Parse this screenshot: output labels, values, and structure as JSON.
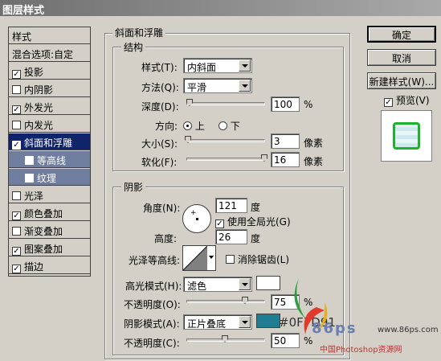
{
  "window": {
    "title": "图层样式"
  },
  "sidebar": {
    "items": [
      {
        "label": "样式",
        "checkbox": false,
        "checked": false,
        "state": "normal"
      },
      {
        "label": "混合选项:自定",
        "checkbox": false,
        "checked": false,
        "state": "normal"
      },
      {
        "label": "投影",
        "checkbox": true,
        "checked": true,
        "state": "normal"
      },
      {
        "label": "内阴影",
        "checkbox": true,
        "checked": false,
        "state": "normal"
      },
      {
        "label": "外发光",
        "checkbox": true,
        "checked": true,
        "state": "normal"
      },
      {
        "label": "内发光",
        "checkbox": true,
        "checked": false,
        "state": "normal"
      },
      {
        "label": "斜面和浮雕",
        "checkbox": true,
        "checked": true,
        "state": "selected"
      },
      {
        "label": "等高线",
        "checkbox": true,
        "checked": false,
        "state": "sub"
      },
      {
        "label": "纹理",
        "checkbox": true,
        "checked": false,
        "state": "sub"
      },
      {
        "label": "光泽",
        "checkbox": true,
        "checked": false,
        "state": "normal"
      },
      {
        "label": "颜色叠加",
        "checkbox": true,
        "checked": true,
        "state": "normal"
      },
      {
        "label": "渐变叠加",
        "checkbox": true,
        "checked": false,
        "state": "normal"
      },
      {
        "label": "图案叠加",
        "checkbox": true,
        "checked": true,
        "state": "normal"
      },
      {
        "label": "描边",
        "checkbox": true,
        "checked": true,
        "state": "normal"
      }
    ]
  },
  "bevel": {
    "group_title": "斜面和浮雕",
    "structure": {
      "title": "结构",
      "style_label": "样式(T):",
      "style_value": "内斜面",
      "technique_label": "方法(Q):",
      "technique_value": "平滑",
      "depth_label": "深度(D):",
      "depth_value": "100",
      "depth_unit": "%",
      "direction_label": "方向:",
      "direction_up": "上",
      "direction_down": "下",
      "direction_selected": "上",
      "size_label": "大小(S):",
      "size_value": "3",
      "size_unit": "像素",
      "soften_label": "软化(F):",
      "soften_value": "16",
      "soften_unit": "像素"
    },
    "shading": {
      "title": "阴影",
      "angle_label": "角度(N):",
      "angle_value": "121",
      "angle_unit": "度",
      "global_light_label": "使用全局光(G)",
      "global_light_checked": true,
      "altitude_label": "高度:",
      "altitude_value": "26",
      "altitude_unit": "度",
      "gloss_contour_label": "光泽等高线:",
      "anti_aliased_label": "消除锯齿(L)",
      "anti_aliased_checked": false,
      "highlight_mode_label": "高光模式(H):",
      "highlight_mode_value": "滤色",
      "highlight_color": "#ffffff",
      "highlight_opacity_label": "不透明度(O):",
      "highlight_opacity_value": "75",
      "shadow_mode_label": "阴影模式(A):",
      "shadow_mode_value": "正片叠底",
      "shadow_color": "#1f7d91",
      "shadow_color_text": "#0F7D91",
      "shadow_opacity_label": "不透明度(C):",
      "shadow_opacity_value": "50",
      "percent": "%"
    }
  },
  "buttons": {
    "ok": "确定",
    "cancel": "取消",
    "new_style": "新建样式(W)...",
    "preview_label": "预览(V)",
    "preview_checked": true
  },
  "watermark": {
    "logo_text": "86ps",
    "url": "www.86ps.com",
    "site_name": "中国Photoshop资源网"
  }
}
